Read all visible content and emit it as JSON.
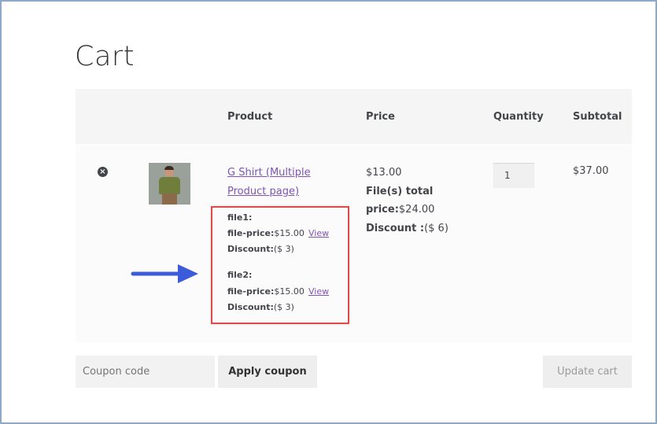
{
  "page": {
    "title": "Cart"
  },
  "table": {
    "headers": {
      "product": "Product",
      "price": "Price",
      "quantity": "Quantity",
      "subtotal": "Subtotal"
    }
  },
  "item": {
    "remove_icon": "close-circle-icon",
    "product_name_line1": "G Shirt (Multiple",
    "product_name_line2": "Product page)",
    "files": [
      {
        "label": "file1:",
        "price_label": "file-price:",
        "price": "$15.00",
        "view": "View",
        "discount_label": "Discount:",
        "discount": "($ 3)"
      },
      {
        "label": "file2:",
        "price_label": "file-price:",
        "price": "$15.00",
        "view": "View",
        "discount_label": "Discount:",
        "discount": "($ 3)"
      }
    ],
    "price": "$13.00",
    "files_total_label_line1": "File(s) total",
    "files_total_label_line2": "price:",
    "files_total_value": "$24.00",
    "discount_label": "Discount :",
    "discount_value": "($ 6)",
    "quantity": "1",
    "subtotal": "$37.00"
  },
  "actions": {
    "coupon_placeholder": "Coupon code",
    "apply_coupon": "Apply coupon",
    "update_cart": "Update cart"
  },
  "colors": {
    "link": "#7f54b3",
    "highlight_border": "#e04a4a",
    "arrow": "#3b5bdb"
  }
}
